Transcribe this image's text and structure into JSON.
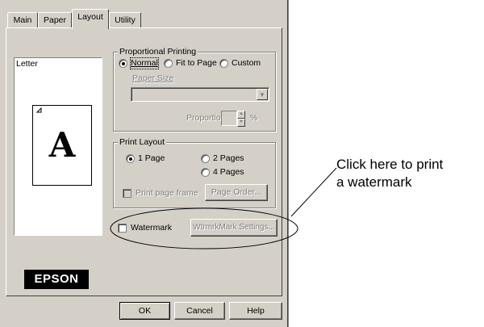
{
  "tabs": [
    {
      "label": "Main"
    },
    {
      "label": "Paper"
    },
    {
      "label": "Layout"
    },
    {
      "label": "Utility"
    }
  ],
  "active_tab": "Layout",
  "preview": {
    "paper_label": "Letter",
    "sample_glyph": "A"
  },
  "proportional_printing": {
    "title": "Proportional Printing",
    "options": [
      "Normal",
      "Fit to Page",
      "Custom"
    ],
    "selected": "Normal",
    "paper_size_label": "Paper Size",
    "paper_size_value": "",
    "proportion_label": "Proportion",
    "proportion_value": "",
    "proportion_unit": "%"
  },
  "print_layout": {
    "title": "Print Layout",
    "options": [
      "1 Page",
      "2 Pages",
      "4 Pages"
    ],
    "selected": "1 Page",
    "print_page_frame_label": "Print page frame",
    "page_order_button": "Page Order..."
  },
  "watermark": {
    "checkbox_label": "Watermark",
    "checked": false,
    "settings_button": "WtrmrkMark Settings..."
  },
  "brand": "EPSON",
  "footer": {
    "ok": "OK",
    "cancel": "Cancel",
    "help": "Help"
  },
  "callout": {
    "line1": "Click here to print",
    "line2": "a watermark"
  }
}
